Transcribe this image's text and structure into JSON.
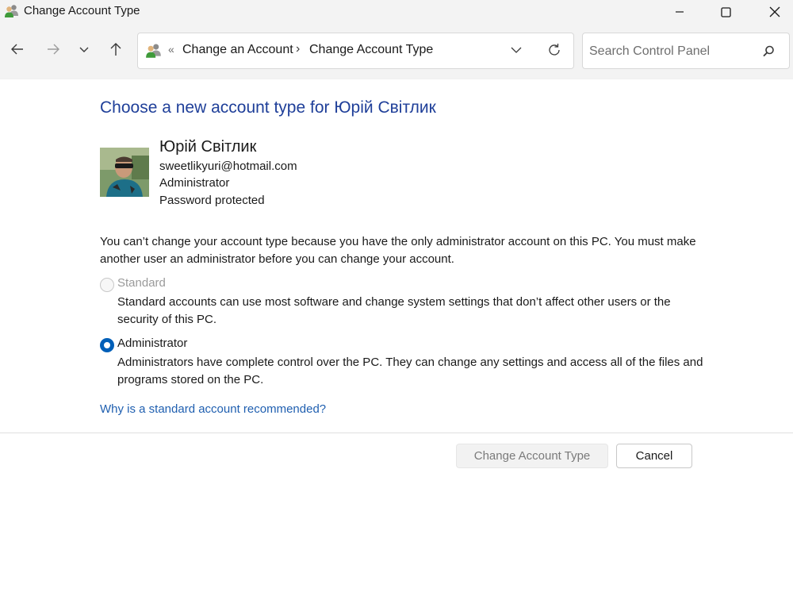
{
  "window": {
    "title": "Change Account Type",
    "app_icon": "users-icon",
    "controls": [
      "minimize-icon",
      "maximize-icon",
      "close-icon"
    ]
  },
  "nav": {
    "buttons": [
      "back-arrow-icon",
      "forward-arrow-icon",
      "recent-locations-chevron-icon",
      "up-arrow-icon"
    ],
    "breadcrumb": {
      "overflow": "«",
      "items": [
        "Change an Account",
        "Change Account Type"
      ],
      "separator": "›"
    },
    "search_placeholder": "Search Control Panel"
  },
  "main": {
    "heading": "Choose a new account type for Юрій Світлик",
    "user": {
      "name": "Юрій Світлик",
      "email": "sweetlikyuri@hotmail.com",
      "role": "Administrator",
      "status": "Password protected"
    },
    "notice": "You can’t change your account type because you have the only administrator account on this PC. You must make another user an administrator before you can change your account.",
    "options": [
      {
        "label": "Standard",
        "description": "Standard accounts can use most software and change system settings that don’t affect other users or the security of this PC.",
        "selected": false,
        "disabled": true
      },
      {
        "label": "Administrator",
        "description": "Administrators have complete control over the PC. They can change any settings and access all of the files and programs stored on the PC.",
        "selected": true,
        "disabled": false
      }
    ],
    "help_link": "Why is a standard account recommended?"
  },
  "footer": {
    "primary_button": "Change Account Type",
    "primary_disabled": true,
    "cancel_button": "Cancel"
  },
  "colors": {
    "heading": "#1f3f99",
    "link": "#1f5fb0",
    "radio_accent": "#005fb8",
    "chrome": "#f3f3f3"
  }
}
